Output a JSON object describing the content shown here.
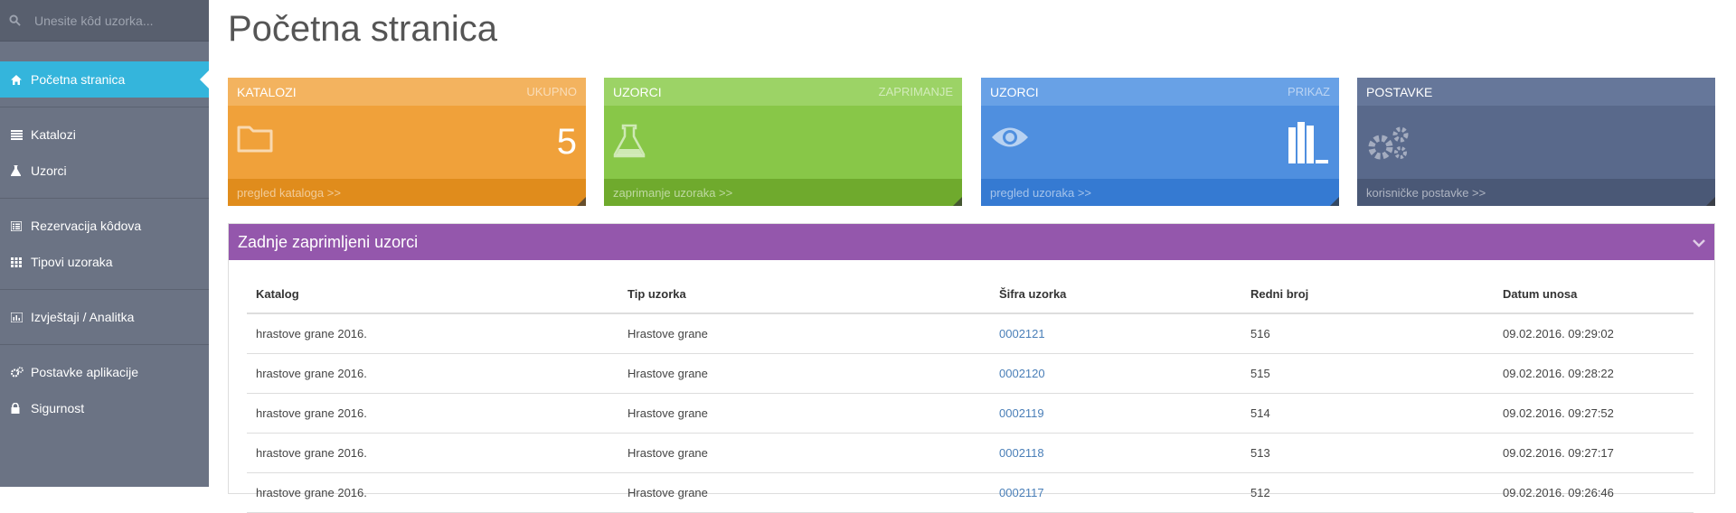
{
  "search": {
    "placeholder": "Unesite kôd uzorka..."
  },
  "sidebar": {
    "items": [
      {
        "label": "Početna stranica",
        "icon": "home-icon"
      },
      {
        "label": "Katalozi",
        "icon": "list-icon"
      },
      {
        "label": "Uzorci",
        "icon": "flask-icon"
      },
      {
        "label": "Rezervacija kôdova",
        "icon": "list-alt-icon"
      },
      {
        "label": "Tipovi uzoraka",
        "icon": "grid-icon"
      },
      {
        "label": "Izvještaji / Analitka",
        "icon": "bar-chart-icon"
      },
      {
        "label": "Postavke aplikacije",
        "icon": "gears-icon"
      },
      {
        "label": "Sigurnost",
        "icon": "lock-icon"
      }
    ]
  },
  "page": {
    "title": "Početna stranica"
  },
  "tiles": [
    {
      "title": "KATALOZI",
      "subtitle": "UKUPNO",
      "count": "5",
      "footer": "pregled kataloga >>",
      "icon": "folder-icon",
      "color": "#f0a13a",
      "header_color": "#f3b35f",
      "footer_color": "#e08c1c"
    },
    {
      "title": "UZORCI",
      "subtitle": "ZAPRIMANJE",
      "footer": "zaprimanje uzoraka >>",
      "icon": "flask-icon",
      "color": "#88c748",
      "header_color": "#9cd366",
      "footer_color": "#6faa2d"
    },
    {
      "title": "UZORCI",
      "subtitle": "PRIKAZ",
      "footer": "pregled uzoraka >>",
      "icon": "eye-icon",
      "icon2": "library-icon",
      "color": "#4f8fdf",
      "header_color": "#68a1e6",
      "footer_color": "#357ad2"
    },
    {
      "title": "POSTAVKE",
      "subtitle": "",
      "footer": "korisničke postavke >>",
      "icon": "gears-icon",
      "color": "#59698b",
      "header_color": "#66779a",
      "footer_color": "#4a5876"
    }
  ],
  "panel": {
    "title": "Zadnje zaprimljeni uzorci",
    "columns": [
      "Katalog",
      "Tip uzorka",
      "Šifra uzorka",
      "Redni broj",
      "Datum unosa"
    ],
    "rows": [
      [
        "hrastove grane 2016.",
        "Hrastove grane",
        "0002121",
        "516",
        "09.02.2016. 09:29:02"
      ],
      [
        "hrastove grane 2016.",
        "Hrastove grane",
        "0002120",
        "515",
        "09.02.2016. 09:28:22"
      ],
      [
        "hrastove grane 2016.",
        "Hrastove grane",
        "0002119",
        "514",
        "09.02.2016. 09:27:52"
      ],
      [
        "hrastove grane 2016.",
        "Hrastove grane",
        "0002118",
        "513",
        "09.02.2016. 09:27:17"
      ],
      [
        "hrastove grane 2016.",
        "Hrastove grane",
        "0002117",
        "512",
        "09.02.2016. 09:26:46"
      ]
    ]
  }
}
